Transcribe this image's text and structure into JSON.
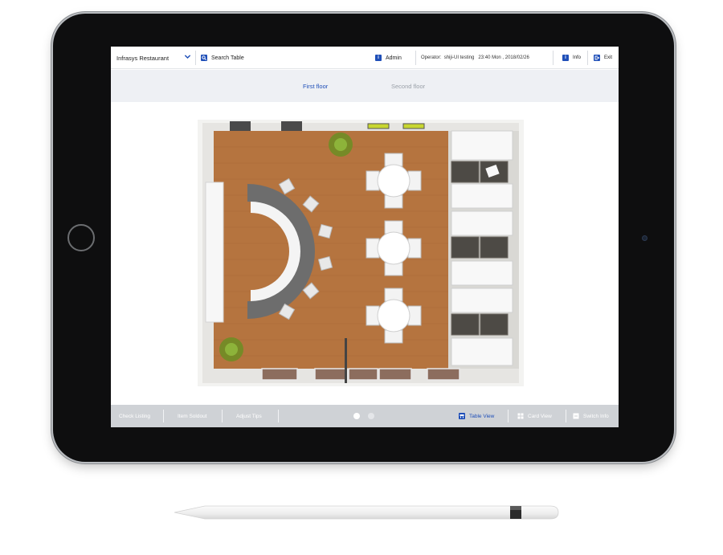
{
  "topbar": {
    "restaurant": "Infrasys Restaurant",
    "search_label": "Search Table",
    "admin_label": "Admin",
    "operator_label": "Operator:",
    "operator_name": "shiji-UI testing",
    "datetime": "23:40 Mon , 2018/02/26",
    "info_label": "Info",
    "exit_label": "Exit"
  },
  "floors": [
    {
      "label": "First floor",
      "active": true
    },
    {
      "label": "Second floor",
      "active": false
    }
  ],
  "bottombar": {
    "check_listing": "Check Listing",
    "item_soldout": "Item Soldout",
    "adjust_tips": "Adjust Tips",
    "table_view": "Table View",
    "card_view": "Card View",
    "switch_info": "Switch Info",
    "pages": 2,
    "current_page": 1
  },
  "colors": {
    "accent": "#1f4fb8",
    "tab_bar_bg": "#eef0f4",
    "bottom_bar_bg": "#cfd2d6",
    "floor_wood": "#b5743f",
    "device_body": "#0e0e0f"
  },
  "icons": {
    "chevron": "chevron-down-icon",
    "search": "search-icon",
    "admin": "admin-icon",
    "info": "info-icon",
    "exit": "exit-icon",
    "table_view": "table-view-icon",
    "card_view": "card-view-icon",
    "switch_info": "switch-info-icon"
  }
}
